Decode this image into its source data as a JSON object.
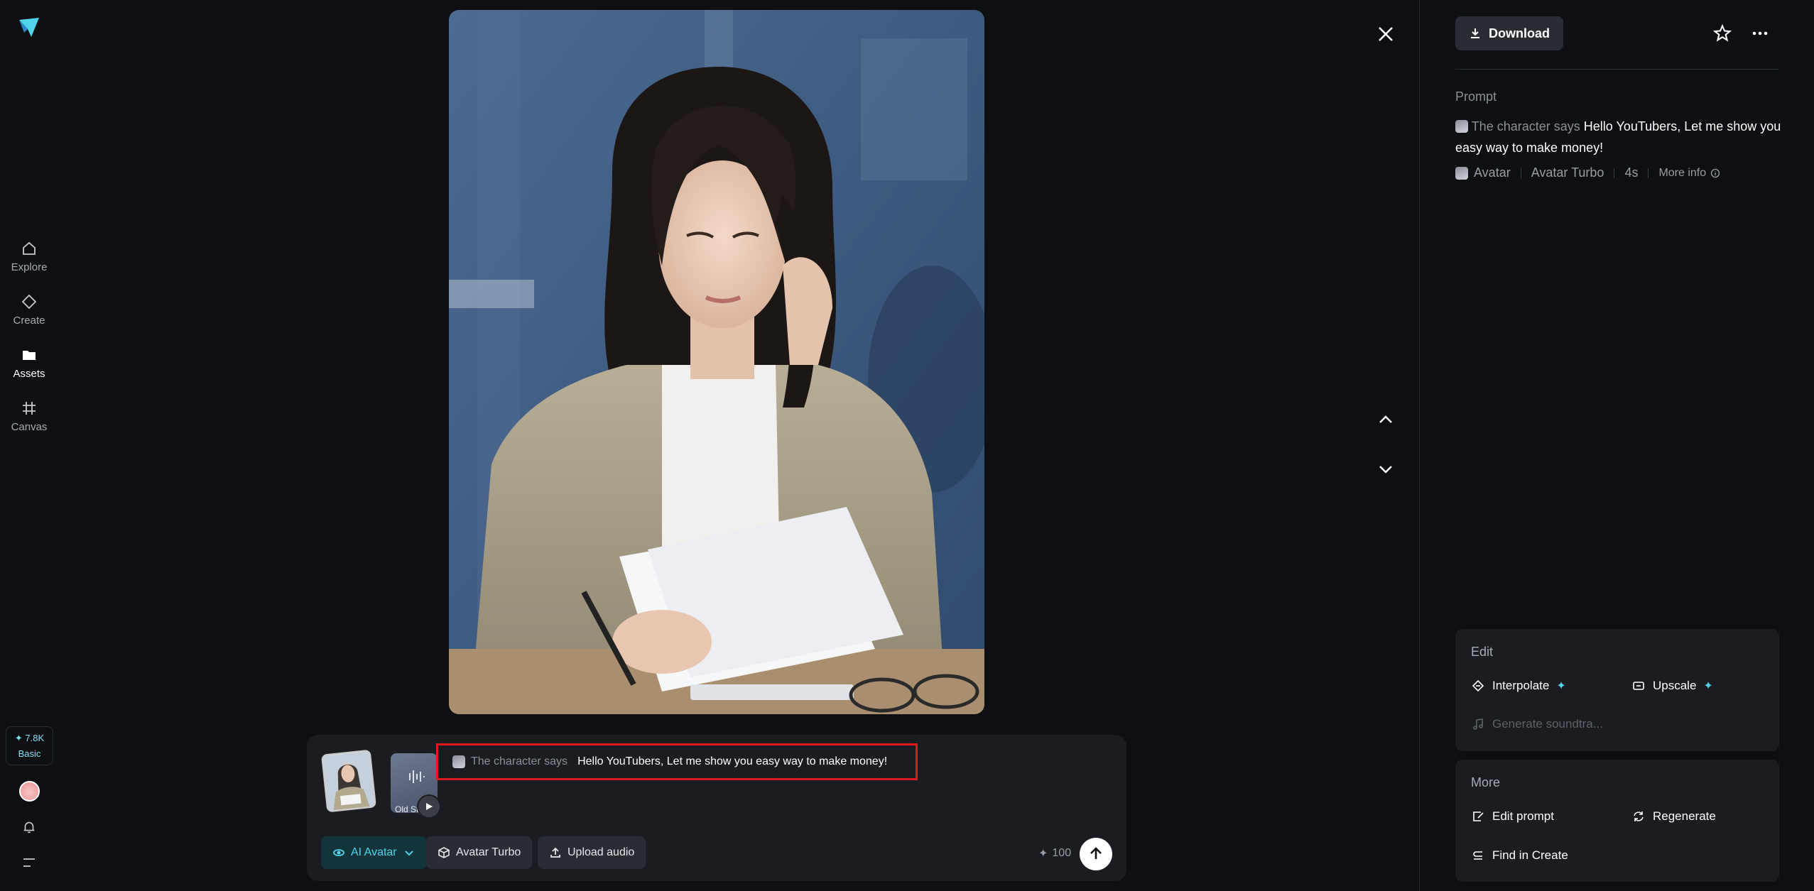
{
  "sidebar": {
    "items": [
      {
        "label": "Explore"
      },
      {
        "label": "Create"
      },
      {
        "label": "Assets"
      },
      {
        "label": "Canvas"
      }
    ],
    "credits": {
      "amount": "✦ 7.8K",
      "plan": "Basic"
    }
  },
  "composer": {
    "audio_thumb_label": "Old Style",
    "prompt_tag": "The character says",
    "prompt_text": "Hello YouTubers, Let me show you easy way to make money!",
    "chips": {
      "mode": "AI Avatar",
      "model": "Avatar Turbo",
      "upload": "Upload audio"
    },
    "cost": "100"
  },
  "right_panel": {
    "download_label": "Download",
    "prompt_label": "Prompt",
    "prompt_tag": "The character says",
    "prompt_text": "Hello YouTubers, Let me show you easy way to make money!",
    "meta": {
      "type": "Avatar",
      "model": "Avatar Turbo",
      "duration": "4s",
      "more_info": "More info"
    },
    "edit": {
      "title": "Edit",
      "interpolate": "Interpolate",
      "upscale": "Upscale",
      "soundtrack": "Generate soundtra..."
    },
    "more": {
      "title": "More",
      "edit_prompt": "Edit prompt",
      "regenerate": "Regenerate",
      "find_in_create": "Find in Create"
    }
  },
  "colors": {
    "background": "#0e0f12",
    "panel": "#1b1c21",
    "accent": "#4fd4ea",
    "highlight_border": "#e0191f"
  }
}
